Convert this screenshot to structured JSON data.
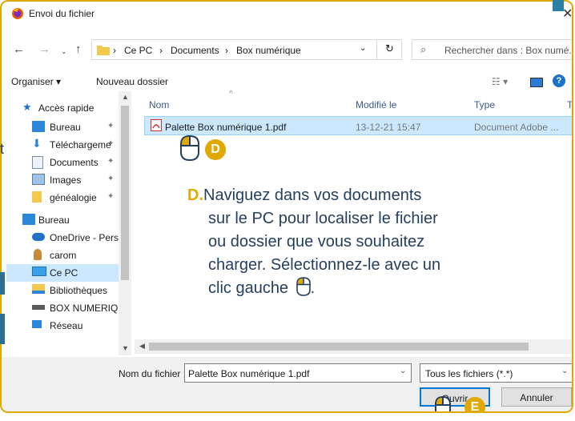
{
  "window": {
    "title": "Envoi du fichier",
    "close_label": "✕"
  },
  "address": {
    "crumbs": [
      "Ce PC",
      "Documents",
      "Box numérique"
    ],
    "search_placeholder": "Rechercher dans : Box numé..."
  },
  "toolbar": {
    "organize_label": "Organiser ▾",
    "new_folder_label": "Nouveau dossier",
    "help_label": "?"
  },
  "sidebar": {
    "items": [
      {
        "label": "Accès rapide",
        "icon": "star-icon",
        "pinned": false
      },
      {
        "label": "Bureau",
        "icon": "desktop-icon",
        "pinned": true
      },
      {
        "label": "Téléchargeme",
        "icon": "download-icon",
        "pinned": true
      },
      {
        "label": "Documents",
        "icon": "documents-icon",
        "pinned": true
      },
      {
        "label": "Images",
        "icon": "images-icon",
        "pinned": true
      },
      {
        "label": "généalogie",
        "icon": "folder-icon",
        "pinned": true
      },
      {
        "label": "Bureau",
        "icon": "desktop-icon",
        "pinned": false
      },
      {
        "label": "OneDrive - Perso",
        "icon": "cloud-icon",
        "pinned": false
      },
      {
        "label": "carom",
        "icon": "user-icon",
        "pinned": false
      },
      {
        "label": "Ce PC",
        "icon": "pc-icon",
        "pinned": false
      },
      {
        "label": "Bibliothèques",
        "icon": "library-icon",
        "pinned": false
      },
      {
        "label": "BOX NUMERIQU",
        "icon": "drive-icon",
        "pinned": false
      },
      {
        "label": "Réseau",
        "icon": "network-icon",
        "pinned": false
      }
    ]
  },
  "file_list": {
    "columns": [
      "Nom",
      "Modifié le",
      "Type",
      "Ta"
    ],
    "rows": [
      {
        "name": "Palette Box numérique 1.pdf",
        "modified": "13-12-21 15:47",
        "type": "Document Adobe ..."
      }
    ]
  },
  "footer": {
    "filename_label": "Nom du fichier :",
    "filename_value": "Palette Box numérique 1.pdf",
    "filetype_value": "Tous les fichiers (*.*)",
    "open_label": "Ouvrir",
    "cancel_label": "Annuler"
  },
  "instructions": {
    "letter": "D.",
    "lines": [
      "Naviguez dans vos documents",
      "sur le PC pour localiser le fichier",
      "ou dossier que vous souhaitez",
      "charger. Sélectionnez-le avec un",
      "clic gauche"
    ],
    "badge_d": "D",
    "badge_e": "E",
    "trailing_period": "."
  },
  "background": {
    "left_letter": "t"
  },
  "colors": {
    "accent": "#e0a800",
    "selection": "#cce8ff",
    "text_blue": "#243f5c",
    "button_focus": "#0078d7"
  }
}
